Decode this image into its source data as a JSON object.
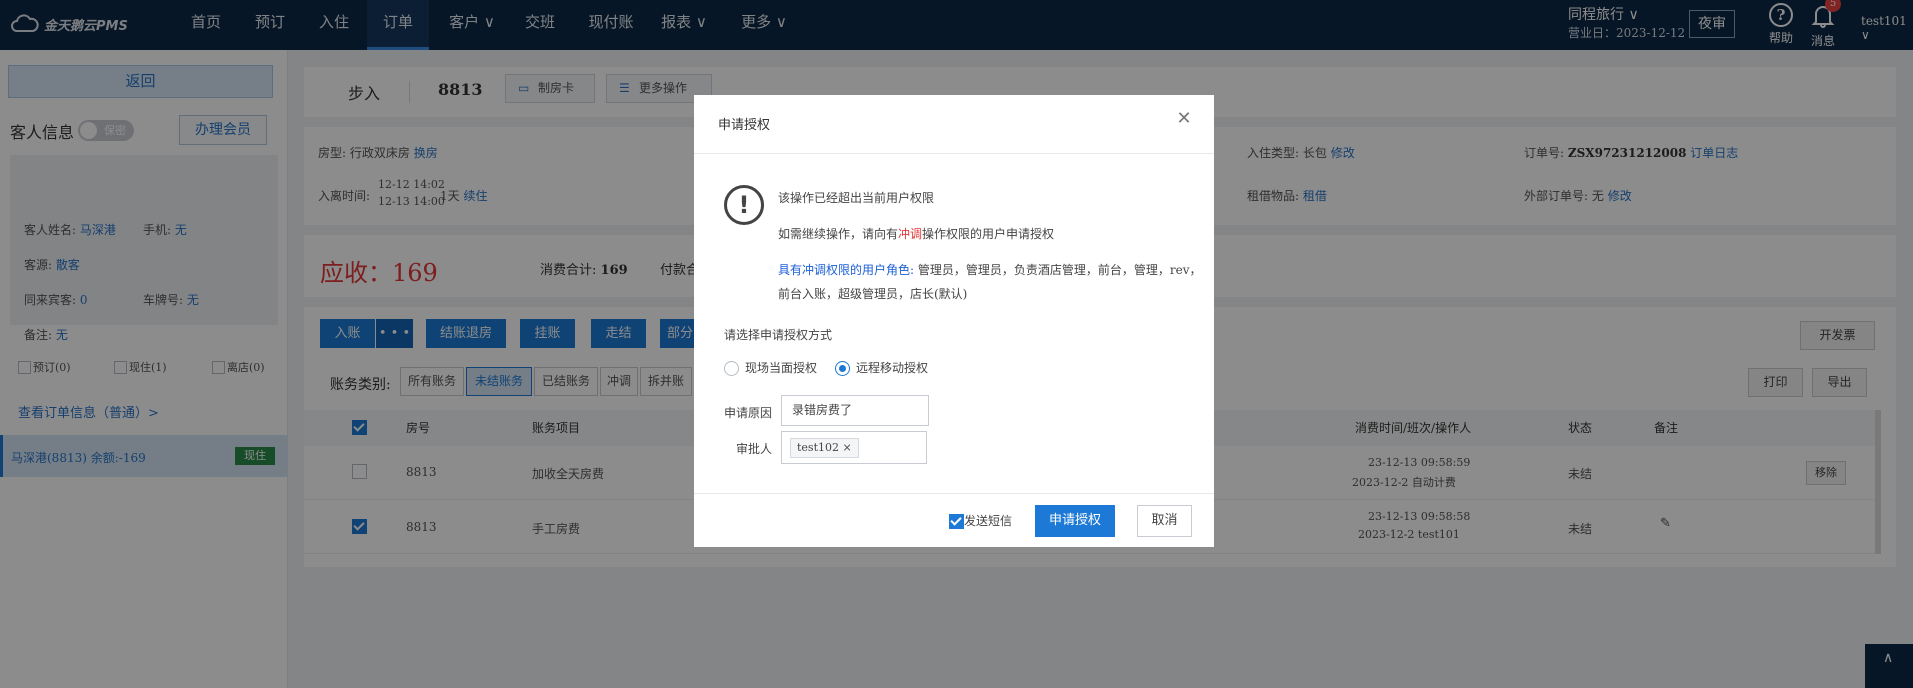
{
  "app": {
    "logo_text": "金天鹅云PMS"
  },
  "nav": {
    "items": [
      {
        "label": "首页",
        "has_arrow": false
      },
      {
        "label": "预订",
        "has_arrow": false
      },
      {
        "label": "入住",
        "has_arrow": false
      },
      {
        "label": "订单",
        "has_arrow": false,
        "active": true
      },
      {
        "label": "客户 ∨",
        "has_arrow": true
      },
      {
        "label": "交班",
        "has_arrow": false
      },
      {
        "label": "现付账",
        "has_arrow": false
      },
      {
        "label": "报表 ∨",
        "has_arrow": true
      },
      {
        "label": "更多 ∨",
        "has_arrow": true
      }
    ],
    "hotel": "同程旅行 ∨",
    "business_date": "营业日：2023-12-12",
    "night_audit": "夜审",
    "help": "帮助",
    "messages": "消息",
    "message_count": "5",
    "user": "test101 ∨"
  },
  "sidebar": {
    "back": "返回",
    "guest_info_title": "客人信息",
    "privacy_toggle": "保密",
    "member_button": "办理会员",
    "guest": {
      "name_label": "客人姓名:",
      "name": "马深港",
      "phone_label": "手机:",
      "phone": "无",
      "source_label": "客源:",
      "source": "散客",
      "companions_label": "同来宾客:",
      "companions": "0",
      "plate_label": "车牌号:",
      "plate": "无",
      "note_label": "备注:",
      "note": "无"
    },
    "filters": [
      "预订(0)",
      "现住(1)",
      "离店(0)"
    ],
    "order_link": "查看订单信息（普通）>",
    "selected_guest": "马深港(8813)   余额:-169",
    "selected_status": "现住"
  },
  "main": {
    "header": {
      "status": "步入",
      "room": "8813",
      "make_card": "制房卡",
      "more_ops": "更多操作"
    },
    "info": {
      "room_type_label": "房型:",
      "room_type": "行政双床房",
      "change_room": "换房",
      "checkin_label": "入离时间:",
      "checkin_time": "12-12 14:02",
      "checkout_time": "12-13 14:00",
      "nights": "1天",
      "extend": "续住",
      "stay_type_label": "入住类型:",
      "stay_type": "长包",
      "modify": "修改",
      "rent_label": "租借物品:",
      "rent": "租借",
      "order_no_label": "订单号:",
      "order_no": "ZSX97231212008",
      "order_log": "订单日志",
      "ext_order_label": "外部订单号:",
      "ext_order": "无",
      "ext_modify": "修改"
    },
    "receivable": "应收：169",
    "consume_total_label": "消费合计:",
    "consume_total": "169",
    "payment_label": "付款合",
    "actions": {
      "post": "入账",
      "more": "• • •",
      "settle_checkout": "结账退房",
      "hang": "挂账",
      "walk": "走结",
      "partial": "部分",
      "invoice": "开发票",
      "print": "打印",
      "export": "导出"
    },
    "tabs_label": "账务类别:",
    "tabs": [
      "所有账务",
      "未结账务",
      "已结账务",
      "冲调",
      "拆并账"
    ],
    "table": {
      "headers": [
        "房号",
        "账务项目",
        "消费时间/班次/操作人",
        "状态",
        "备注"
      ],
      "rows": [
        {
          "room": "8813",
          "item": "加收全天房费",
          "time": "23-12-13 09:58:59",
          "shift": "2023-12-2 自动计费",
          "status": "未结",
          "action": "移除",
          "checked": false
        },
        {
          "room": "8813",
          "item": "手工房费",
          "time": "23-12-13 09:58:58",
          "shift": "2023-12-2 test101",
          "status": "未结",
          "action": "",
          "checked": true
        }
      ]
    }
  },
  "modal": {
    "title": "申请授权",
    "msg1": "该操作已经超出当前用户权限",
    "msg2_pre": "如需继续操作，请向有",
    "msg2_red": "冲调",
    "msg2_post": "操作权限的用户申请授权",
    "roles_label": "具有冲调权限的用户角色:",
    "roles_line1": "管理员，管理员，负责酒店管理，前台，管理，rev，",
    "roles_line2": "前台入账，超级管理员，店长(默认)",
    "method_label": "请选择申请授权方式",
    "method_onsite": "现场当面授权",
    "method_remote": "远程移动授权",
    "reason_label": "申请原因",
    "reason_value": "录错房费了",
    "approver_label": "审批人",
    "approver_tag": "test102",
    "send_sms": "发送短信",
    "submit": "申请授权",
    "cancel": "取消"
  }
}
